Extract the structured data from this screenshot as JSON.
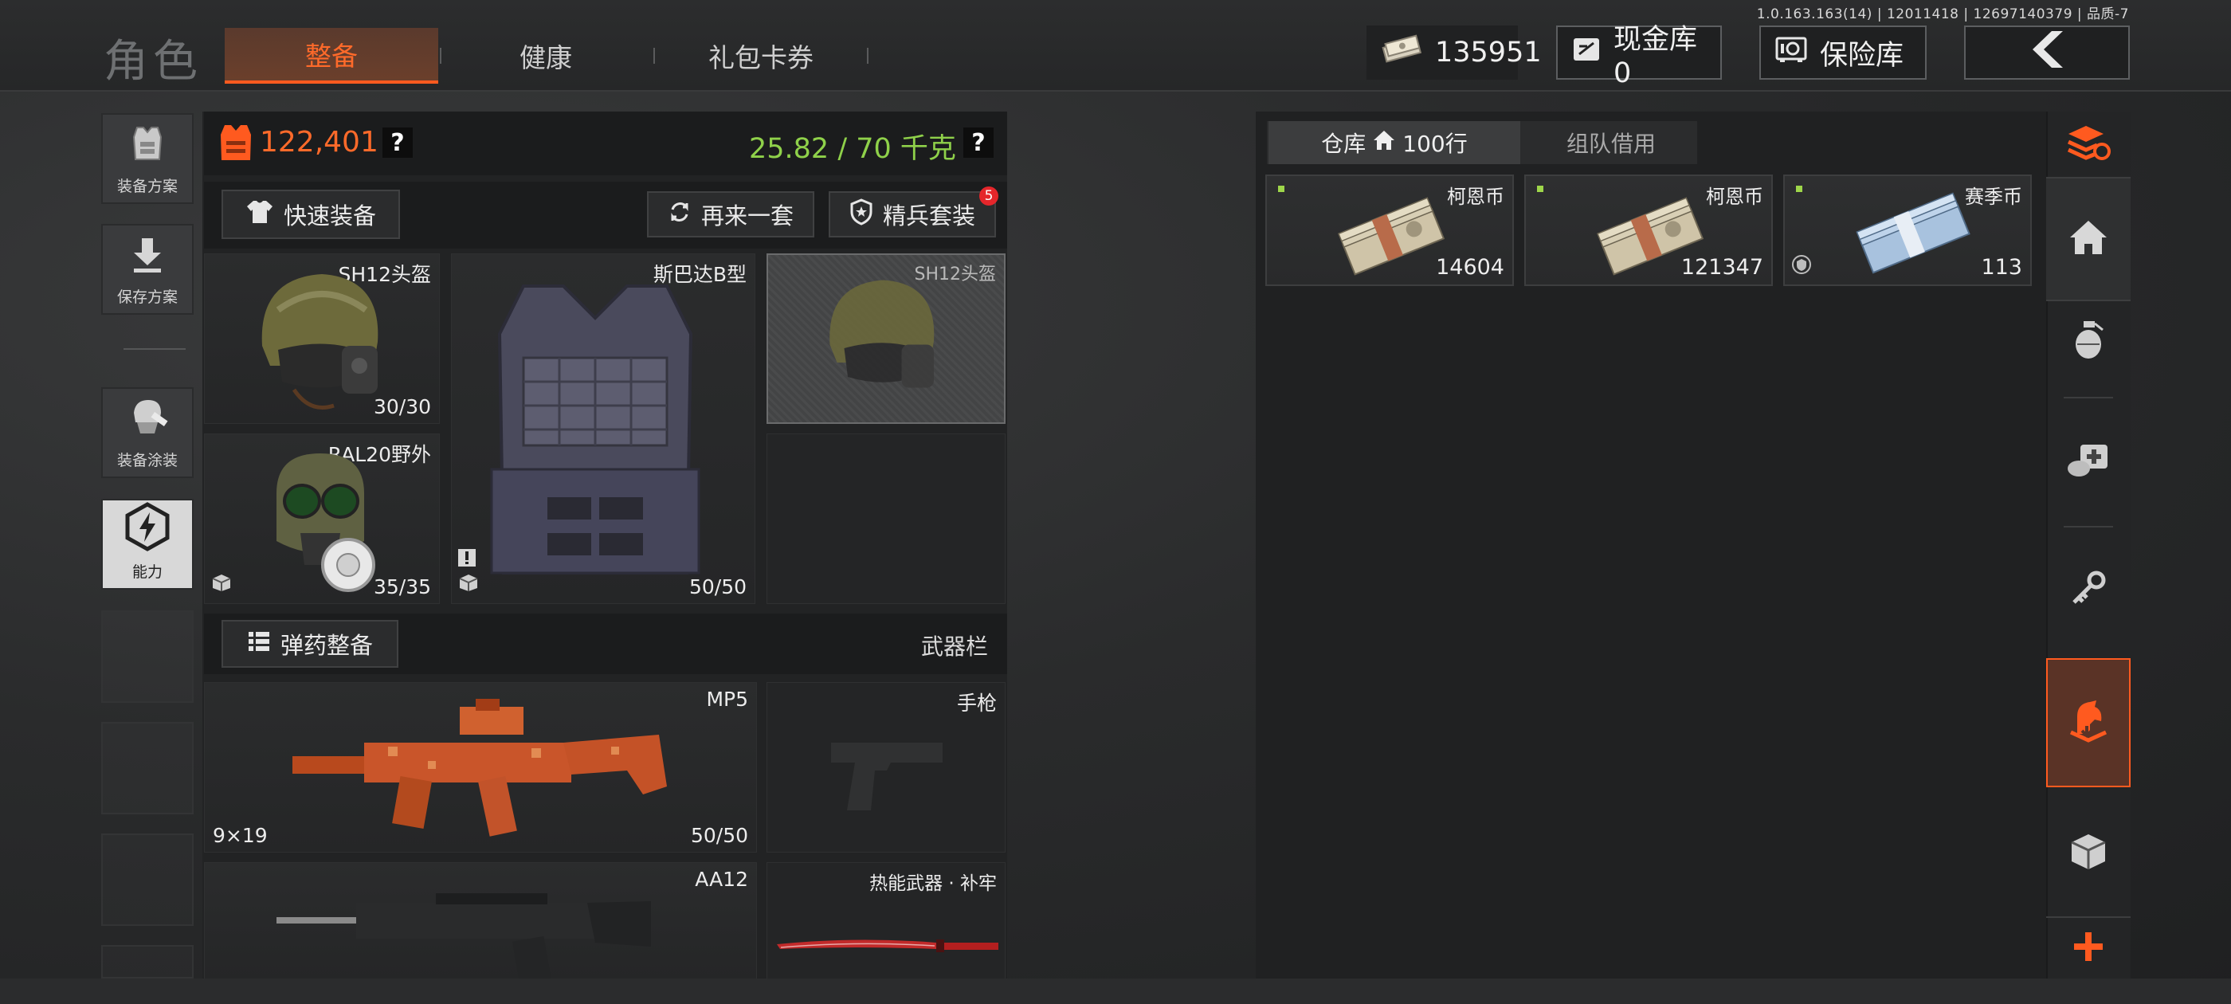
{
  "build_info": "1.0.163.163(14) | 12011418 | 12697140379 | 品质-7",
  "header": {
    "title": "角色",
    "tabs": [
      {
        "label": "整备",
        "active": true
      },
      {
        "label": "健康",
        "active": false
      },
      {
        "label": "礼包卡券",
        "active": false
      }
    ],
    "cash": "135951",
    "cash_vault": "现金库 0",
    "safe_vault": "保险库"
  },
  "sidebar": {
    "items": [
      {
        "label": "装备方案",
        "icon": "vest-plan-icon"
      },
      {
        "label": "保存方案",
        "icon": "save-download-icon"
      },
      {
        "label": "装备涂装",
        "icon": "gear-paint-icon"
      },
      {
        "label": "能力",
        "icon": "ability-bolt-icon"
      }
    ]
  },
  "equip": {
    "value": "122,401",
    "weight": "25.82 / 70 千克",
    "quick_equip": "快速装备",
    "again_set": "再来一套",
    "elite_set": "精兵套装",
    "elite_badge": "5",
    "slots": {
      "helmet": {
        "name": "SH12头盔",
        "durability": "30/30"
      },
      "armor": {
        "name": "斯巴达B型",
        "durability": "50/50"
      },
      "helmet_preview": {
        "name": "SH12头盔"
      },
      "mask": {
        "name": "RAL20野外",
        "durability": "35/35"
      }
    },
    "ammo_equip": "弹药整备",
    "weapon_bar": "武器栏",
    "weapons": {
      "primary": {
        "name": "MP5",
        "ammo": "9×19",
        "durability": "50/50"
      },
      "pistol": {
        "name": "手枪"
      },
      "secondary": {
        "name": "AA12"
      },
      "melee": {
        "name": "热能武器 · 补牢"
      }
    }
  },
  "warehouse": {
    "tab_storage": "仓库",
    "tab_rows": "100行",
    "tab_team": "组队借用",
    "items": [
      {
        "name": "柯恩币",
        "count": "14604"
      },
      {
        "name": "柯恩币",
        "count": "121347"
      },
      {
        "name": "赛季币",
        "count": "113"
      }
    ]
  },
  "colors": {
    "accent": "#ff5a1f",
    "weight_green": "#8fd14a",
    "value_orange": "#ff6a2a",
    "tag_green": "#9ed64a"
  }
}
